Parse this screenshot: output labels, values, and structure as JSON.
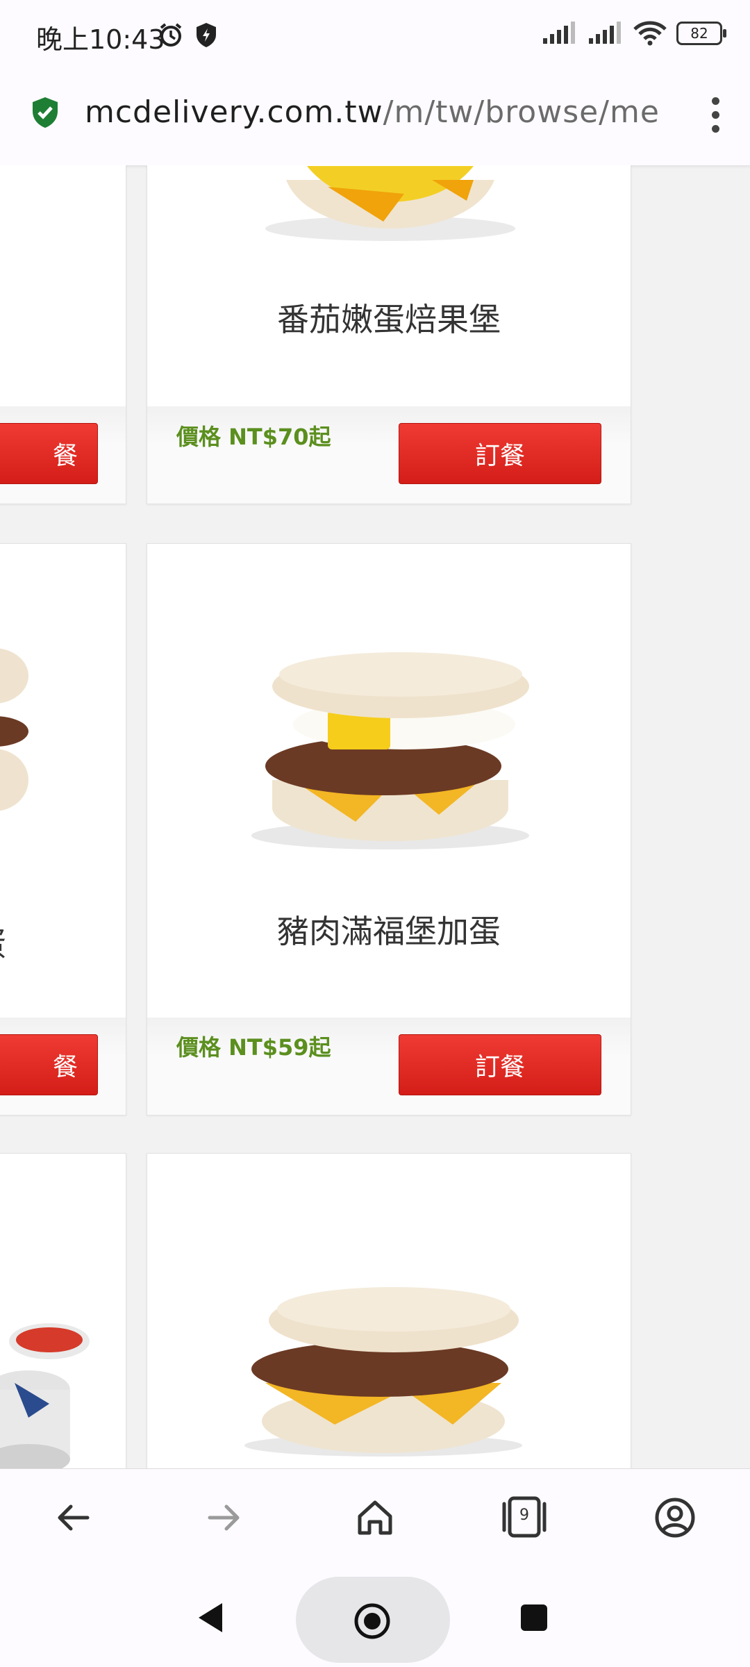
{
  "status_bar": {
    "time": "晚上10:43",
    "battery": "82"
  },
  "url_bar": {
    "domain": "mcdelivery.com.tw",
    "path": "/m/tw/browse/menu"
  },
  "menu_items": [
    {
      "name": "番茄嫩蛋焙果堡",
      "price": "價格 NT$70起",
      "button": "訂餐"
    },
    {
      "name": "豬肉滿福堡加蛋",
      "price": "價格 NT$59起",
      "button": "訂餐"
    }
  ],
  "left_column": {
    "partial_name": "蛋",
    "button_partial": "餐"
  },
  "nav": {
    "tab_count": "9"
  },
  "colors": {
    "accent_red": "#e22d25",
    "price_green": "#5b8f1e"
  }
}
